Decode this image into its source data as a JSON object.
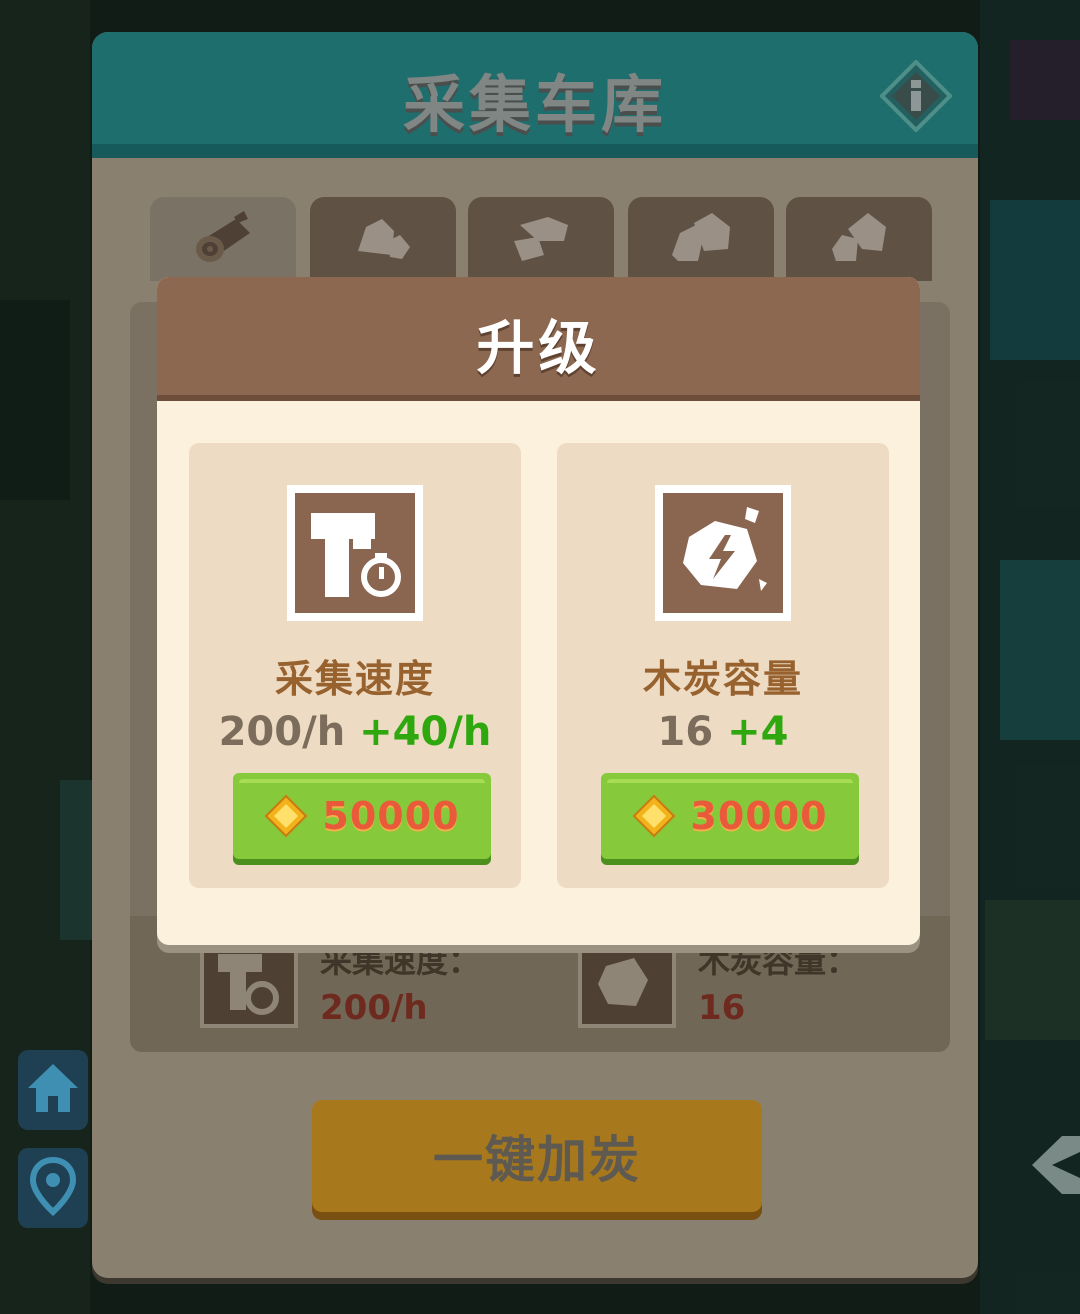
{
  "panel": {
    "title": "采集车库",
    "tabs": [
      {
        "icon": "wood-log-icon"
      },
      {
        "icon": "stone-icon"
      },
      {
        "icon": "stone-icon"
      },
      {
        "icon": "stone-icon"
      },
      {
        "icon": "stone-icon"
      }
    ],
    "stats": {
      "speed_label": "采集速度：",
      "speed_value": "200/h",
      "capacity_label": "木炭容量：",
      "capacity_value": "16"
    },
    "add_charcoal_button": "一键加炭"
  },
  "upgrade_dialog": {
    "title": "升级",
    "cards": [
      {
        "icon": "hammer-timer-icon",
        "title": "采集速度",
        "current": "200/h",
        "increase": "+40/h",
        "price": "50000",
        "currency_icon": "gem-icon"
      },
      {
        "icon": "charcoal-lightning-icon",
        "title": "木炭容量",
        "current": "16",
        "increase": "+4",
        "price": "30000",
        "currency_icon": "gem-icon"
      }
    ]
  },
  "side_buttons": [
    {
      "icon": "home-icon"
    },
    {
      "icon": "location-pin-icon"
    }
  ],
  "colors": {
    "panel_header": "#1f6e6e",
    "dialog_header": "#8c6850",
    "buy_button": "#86c93a",
    "price_text": "#e95a3a",
    "increase_text": "#2ea80e"
  }
}
